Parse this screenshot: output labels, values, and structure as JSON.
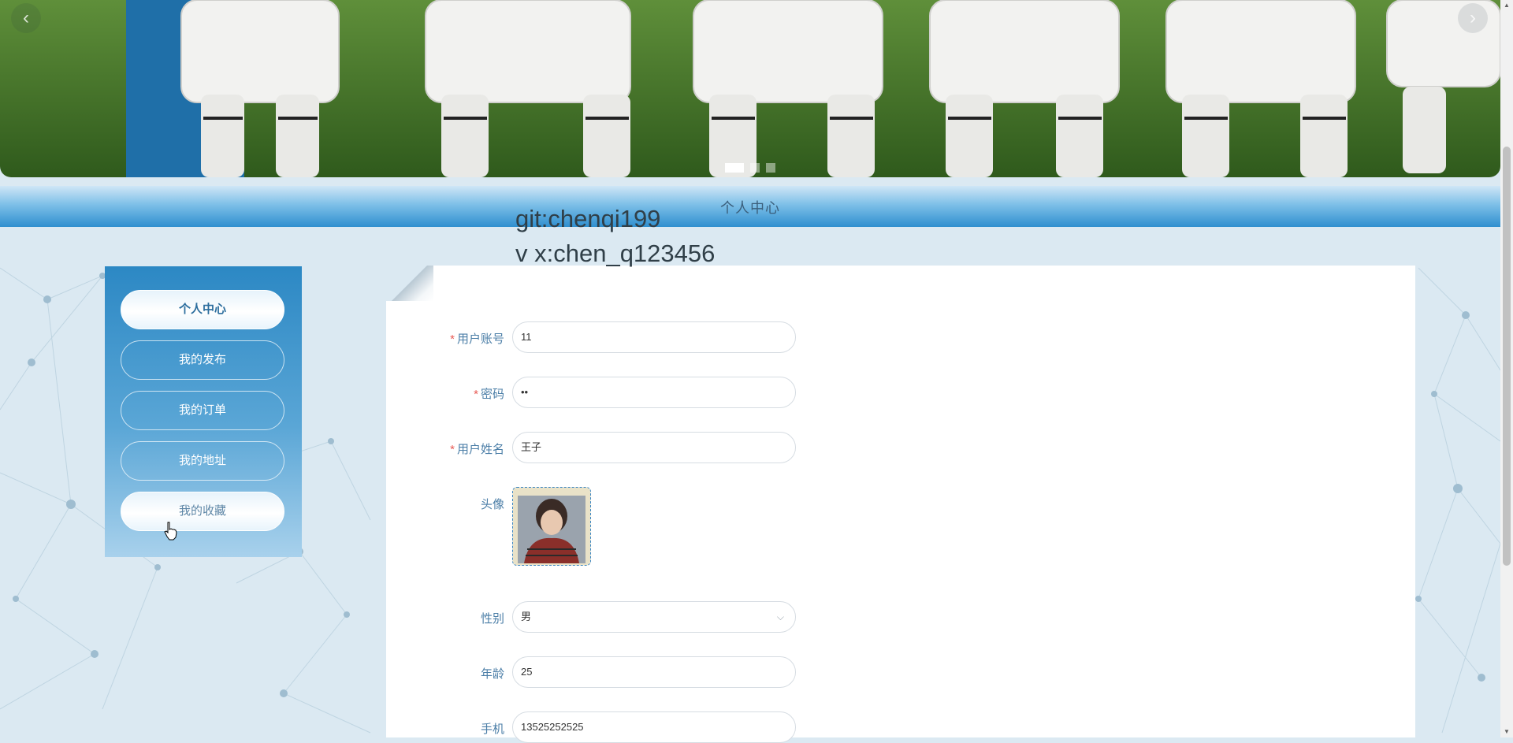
{
  "banner": {
    "prev_symbol": "‹",
    "next_symbol": "›",
    "slide_count": 3,
    "active_slide": 1
  },
  "header": {
    "title": "个人中心"
  },
  "watermark": {
    "line1": "git:chenqi199",
    "line2": "v x:chen_q123456"
  },
  "sidebar": {
    "items": [
      {
        "label": "个人中心",
        "state": "active"
      },
      {
        "label": "我的发布",
        "state": "normal"
      },
      {
        "label": "我的订单",
        "state": "normal"
      },
      {
        "label": "我的地址",
        "state": "normal"
      },
      {
        "label": "我的收藏",
        "state": "hover"
      }
    ]
  },
  "form": {
    "required_mark": "*",
    "account_label": "用户账号",
    "account_value": "11",
    "password_label": "密码",
    "password_value": "••",
    "name_label": "用户姓名",
    "name_value": "王子",
    "avatar_label": "头像",
    "gender_label": "性别",
    "gender_value": "男",
    "age_label": "年龄",
    "age_value": "25",
    "phone_label": "手机",
    "phone_value": "13525252525"
  },
  "colors": {
    "accent": "#2c88c4",
    "label": "#4b7ea7",
    "required": "#e85b55"
  }
}
